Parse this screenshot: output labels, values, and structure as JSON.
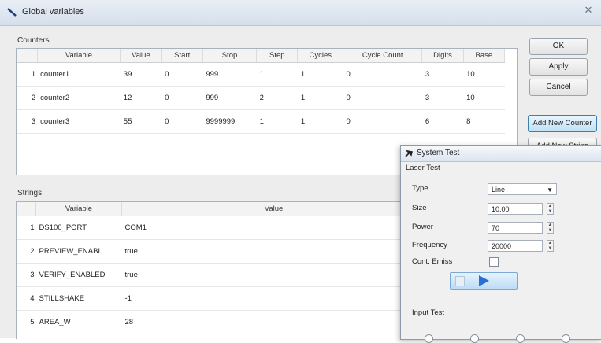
{
  "window": {
    "title": "Global variables"
  },
  "counters": {
    "label": "Counters",
    "columns": [
      "Variable",
      "Value",
      "Start",
      "Stop",
      "Step",
      "Cycles",
      "Cycle Count",
      "Digits",
      "Base"
    ],
    "rows": [
      {
        "num": "1",
        "cells": [
          "counter1",
          "39",
          "0",
          "999",
          "1",
          "1",
          "0",
          "3",
          "10"
        ]
      },
      {
        "num": "2",
        "cells": [
          "counter2",
          "12",
          "0",
          "999",
          "2",
          "1",
          "0",
          "3",
          "10"
        ]
      },
      {
        "num": "3",
        "cells": [
          "counter3",
          "55",
          "0",
          "9999999",
          "1",
          "1",
          "0",
          "6",
          "8"
        ]
      }
    ]
  },
  "strings": {
    "label": "Strings",
    "columns": [
      "Variable",
      "Value"
    ],
    "rows": [
      {
        "num": "1",
        "cells": [
          "DS100_PORT",
          "COM1"
        ]
      },
      {
        "num": "2",
        "cells": [
          "PREVIEW_ENABL...",
          "true"
        ]
      },
      {
        "num": "3",
        "cells": [
          "VERIFY_ENABLED",
          "true"
        ]
      },
      {
        "num": "4",
        "cells": [
          "STILLSHAKE",
          "-1"
        ]
      },
      {
        "num": "5",
        "cells": [
          "AREA_W",
          "28"
        ]
      }
    ]
  },
  "buttons": {
    "ok": "OK",
    "apply": "Apply",
    "cancel": "Cancel",
    "add_counter": "Add New Counter",
    "add_string": "Add New String"
  },
  "dialog": {
    "title": "System Test",
    "laser_group": "Laser Test",
    "type_label": "Type",
    "type_value": "Line",
    "size_label": "Size",
    "size_value": "10.00",
    "power_label": "Power",
    "power_value": "70",
    "frequency_label": "Frequency",
    "frequency_value": "20000",
    "dark_label": "Cont. Emiss",
    "input_group": "Input Test"
  },
  "colors": {
    "accent": "#2a6fd0",
    "window_bg": "#ededed"
  }
}
